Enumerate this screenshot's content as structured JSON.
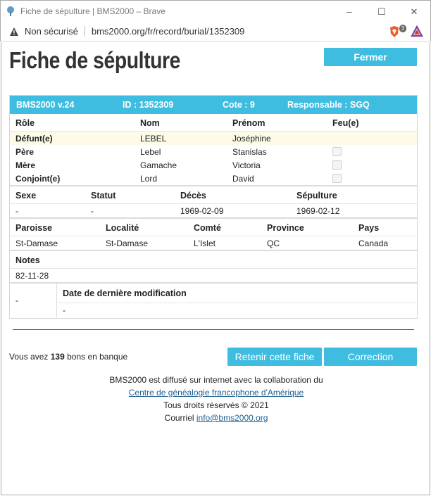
{
  "window": {
    "title": "Fiche de sépulture | BMS2000 – Brave",
    "minimize": "–",
    "maximize": "☐",
    "close": "✕"
  },
  "address": {
    "security": "Non sécurisé",
    "url": "bms2000.org/fr/record/burial/1352309",
    "shields_count": "3"
  },
  "page": {
    "title": "Fiche de sépulture",
    "close_button": "Fermer"
  },
  "record": {
    "header": {
      "version": "BMS2000 v.24",
      "id": "ID : 1352309",
      "cote": "Cote : 9",
      "responsable": "Responsable : SGQ"
    },
    "persons_headers": [
      "Rôle",
      "Nom",
      "Prénom",
      "Feu(e)"
    ],
    "persons": [
      {
        "role": "Défunt(e)",
        "nom": "LEBEL",
        "prenom": "Joséphine"
      },
      {
        "role": "Père",
        "nom": "Lebel",
        "prenom": "Stanislas"
      },
      {
        "role": "Mère",
        "nom": "Gamache",
        "prenom": "Victoria"
      },
      {
        "role": "Conjoint(e)",
        "nom": "Lord",
        "prenom": "David"
      }
    ],
    "vital_headers": [
      "Sexe",
      "Statut",
      "Décès",
      "Sépulture"
    ],
    "vital": {
      "sexe": "-",
      "statut": "-",
      "deces": "1969-02-09",
      "sepulture": "1969-02-12"
    },
    "place_headers": [
      "Paroisse",
      "Localité",
      "Comté",
      "Province",
      "Pays"
    ],
    "place": {
      "paroisse": "St-Damase",
      "localite": "St-Damase",
      "comte": "L'Islet",
      "province": "QC",
      "pays": "Canada"
    },
    "notes_header": "Notes",
    "notes": "82-11-28",
    "lastmod_left": "-",
    "lastmod_header": "Date de dernière modification",
    "lastmod_value": "-"
  },
  "bank": {
    "prefix": "Vous avez",
    "count": "139",
    "suffix": "bons en banque"
  },
  "actions": {
    "keep": "Retenir cette fiche",
    "correction": "Correction"
  },
  "footer": {
    "line1": "BMS2000 est diffusé sur internet avec la collaboration du",
    "link1": "Centre de généalogie francophone d'Amérique",
    "line3": "Tous droits réservés © 2021",
    "line4_prefix": "Courriel",
    "email": "info@bms2000.org"
  },
  "colors": {
    "accent": "#3ebde0",
    "highlight_row": "#fdfbe8"
  }
}
